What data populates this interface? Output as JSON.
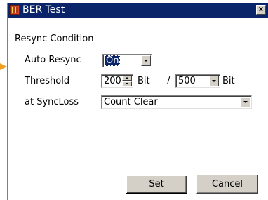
{
  "window": {
    "title": "BER Test",
    "close_label": "×"
  },
  "section": {
    "label": "Resync Condition"
  },
  "auto_resync": {
    "label": "Auto Resync",
    "value": "On"
  },
  "threshold": {
    "label": "Threshold",
    "value": "200",
    "unit1": "Bit",
    "separator": "/",
    "total": "500",
    "unit2": "Bit"
  },
  "sync_loss": {
    "label": "at SyncLoss",
    "value": "Count Clear"
  },
  "buttons": {
    "set": "Set",
    "cancel": "Cancel"
  },
  "icons": {
    "title": "app-icon",
    "pointer": "arrow-pointer"
  },
  "colors": {
    "titlebar": "#0a246a",
    "pointer": "#f0a020",
    "face": "#d4d0c8"
  }
}
